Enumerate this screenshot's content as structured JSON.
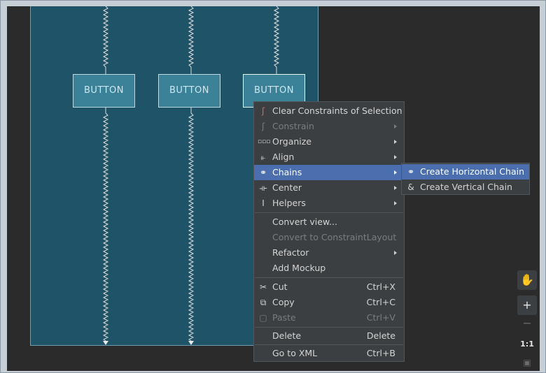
{
  "canvas": {
    "buttons": [
      {
        "label": "BUTTON"
      },
      {
        "label": "BUTTON"
      },
      {
        "label": "BUTTON"
      }
    ]
  },
  "context_menu": {
    "items": [
      {
        "icon": "clear-constraints-icon",
        "label": "Clear Constraints of Selection",
        "shortcut": "",
        "submenu": false,
        "disabled": false
      },
      {
        "icon": "constrain-icon",
        "label": "Constrain",
        "shortcut": "",
        "submenu": true,
        "disabled": true
      },
      {
        "icon": "organize-icon",
        "label": "Organize",
        "shortcut": "",
        "submenu": true,
        "disabled": false
      },
      {
        "icon": "align-icon",
        "label": "Align",
        "shortcut": "",
        "submenu": true,
        "disabled": false
      },
      {
        "icon": "chains-icon",
        "label": "Chains",
        "shortcut": "",
        "submenu": true,
        "disabled": false,
        "highlighted": true
      },
      {
        "icon": "center-icon",
        "label": "Center",
        "shortcut": "",
        "submenu": true,
        "disabled": false
      },
      {
        "icon": "helpers-icon",
        "label": "Helpers",
        "shortcut": "",
        "submenu": true,
        "disabled": false
      },
      {
        "icon": "",
        "label": "Convert view...",
        "shortcut": "",
        "submenu": false,
        "disabled": false
      },
      {
        "icon": "",
        "label": "Convert to ConstraintLayout",
        "shortcut": "",
        "submenu": false,
        "disabled": true
      },
      {
        "icon": "",
        "label": "Refactor",
        "shortcut": "",
        "submenu": true,
        "disabled": false
      },
      {
        "icon": "",
        "label": "Add Mockup",
        "shortcut": "",
        "submenu": false,
        "disabled": false
      },
      {
        "icon": "cut-icon",
        "label": "Cut",
        "shortcut": "Ctrl+X",
        "submenu": false,
        "disabled": false
      },
      {
        "icon": "copy-icon",
        "label": "Copy",
        "shortcut": "Ctrl+C",
        "submenu": false,
        "disabled": false
      },
      {
        "icon": "paste-icon",
        "label": "Paste",
        "shortcut": "Ctrl+V",
        "submenu": false,
        "disabled": true
      },
      {
        "icon": "",
        "label": "Delete",
        "shortcut": "Delete",
        "submenu": false,
        "disabled": false
      },
      {
        "icon": "",
        "label": "Go to XML",
        "shortcut": "Ctrl+B",
        "submenu": false,
        "disabled": false
      }
    ]
  },
  "chains_submenu": {
    "items": [
      {
        "icon": "horizontal-chain-icon",
        "label": "Create Horizontal Chain",
        "highlighted": true
      },
      {
        "icon": "vertical-chain-icon",
        "label": "Create Vertical Chain",
        "highlighted": false
      }
    ]
  },
  "zoom_toolbar": {
    "pan_icon": "hand-icon",
    "zoom_in": "+",
    "zoom_out": "−",
    "actual_size": "1:1",
    "fit_icon": "fit-screen-icon"
  },
  "colors": {
    "blueprint_bg": "#1f5468",
    "menu_bg": "#3c3f41",
    "highlight": "#4b6eaf"
  }
}
